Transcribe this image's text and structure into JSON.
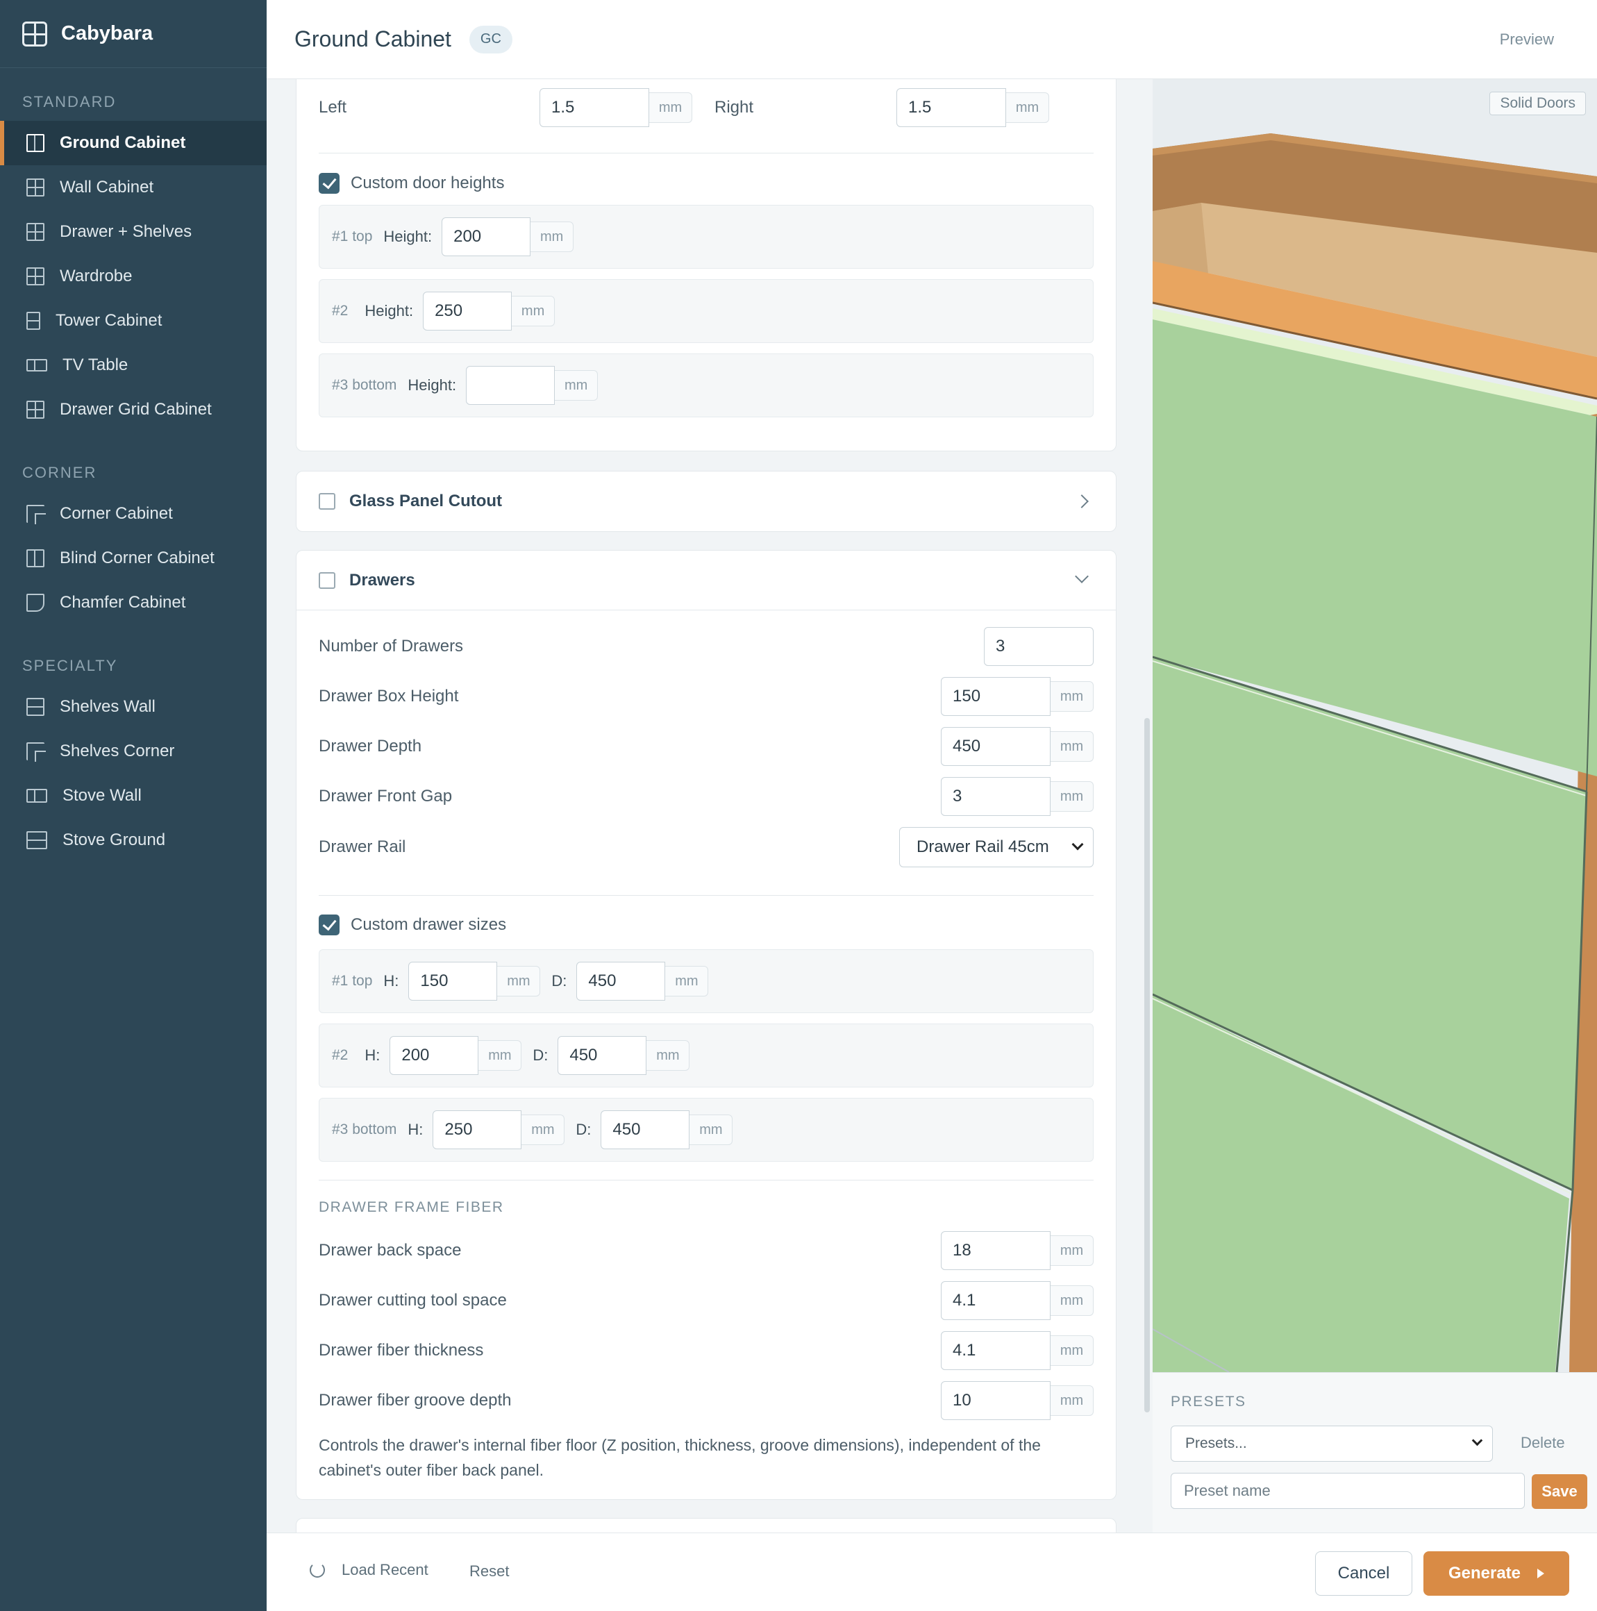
{
  "app": {
    "name": "Cabybara"
  },
  "header": {
    "title": "Ground Cabinet",
    "badge": "GC",
    "preview_label": "Preview"
  },
  "sidebar": {
    "groups": [
      {
        "title": "STANDARD",
        "items": [
          "Ground Cabinet",
          "Wall Cabinet",
          "Drawer + Shelves",
          "Wardrobe",
          "Tower Cabinet",
          "TV Table",
          "Drawer Grid Cabinet"
        ]
      },
      {
        "title": "CORNER",
        "items": [
          "Corner Cabinet",
          "Blind Corner Cabinet",
          "Chamfer Cabinet"
        ]
      },
      {
        "title": "SPECIALTY",
        "items": [
          "Shelves Wall",
          "Shelves Corner",
          "Stove Wall",
          "Stove Ground"
        ]
      }
    ],
    "active_item": "Ground Cabinet"
  },
  "units": {
    "mm": "mm"
  },
  "doors": {
    "left_label": "Left",
    "left_value": "1.5",
    "right_label": "Right",
    "right_value": "1.5",
    "custom_heights_label": "Custom door heights",
    "custom_heights_checked": true,
    "height_label": "Height:",
    "rows": [
      {
        "tag": "#1 top",
        "value": "200"
      },
      {
        "tag": "#2",
        "value": "250"
      },
      {
        "tag": "#3 bottom",
        "value": ""
      }
    ]
  },
  "glass_panel": {
    "title": "Glass Panel Cutout"
  },
  "drawers": {
    "title": "Drawers",
    "number_label": "Number of Drawers",
    "number_value": "3",
    "box_height_label": "Drawer Box Height",
    "box_height_value": "150",
    "depth_label": "Drawer Depth",
    "depth_value": "450",
    "front_gap_label": "Drawer Front Gap",
    "front_gap_value": "3",
    "rail_label": "Drawer Rail",
    "rail_value": "Drawer Rail 45cm",
    "custom_sizes_label": "Custom drawer sizes",
    "custom_sizes_checked": true,
    "h_label": "H:",
    "d_label": "D:",
    "rows": [
      {
        "tag": "#1 top",
        "h": "150",
        "d": "450"
      },
      {
        "tag": "#2",
        "h": "200",
        "d": "450"
      },
      {
        "tag": "#3 bottom",
        "h": "250",
        "d": "450"
      }
    ],
    "fiber": {
      "caption": "DRAWER FRAME FIBER",
      "back_space_label": "Drawer back space",
      "back_space_value": "18",
      "cutting_label": "Drawer cutting tool space",
      "cutting_value": "4.1",
      "thickness_label": "Drawer fiber thickness",
      "thickness_value": "4.1",
      "groove_label": "Drawer fiber groove depth",
      "groove_value": "10",
      "help": "Controls the drawer's internal fiber floor (Z position, thickness, groove dimensions), independent of the cabinet's outer fiber back panel."
    }
  },
  "preview": {
    "mode_label": "Solid Doors"
  },
  "presets": {
    "title": "PRESETS",
    "select_placeholder": "Presets...",
    "delete_label": "Delete",
    "name_placeholder": "Preset name",
    "save_label": "Save"
  },
  "footer": {
    "load_recent_label": "Load Recent",
    "reset_label": "Reset",
    "cancel_label": "Cancel",
    "generate_label": "Generate"
  },
  "colors": {
    "sidebar_bg": "#2d4756",
    "accent": "#d98b45",
    "checkbox": "#3e6476",
    "door_green": "#a8d19c",
    "wood_top": "#b07f4f",
    "wood_light": "#dbb88a",
    "wood_edge": "#e8a560"
  }
}
